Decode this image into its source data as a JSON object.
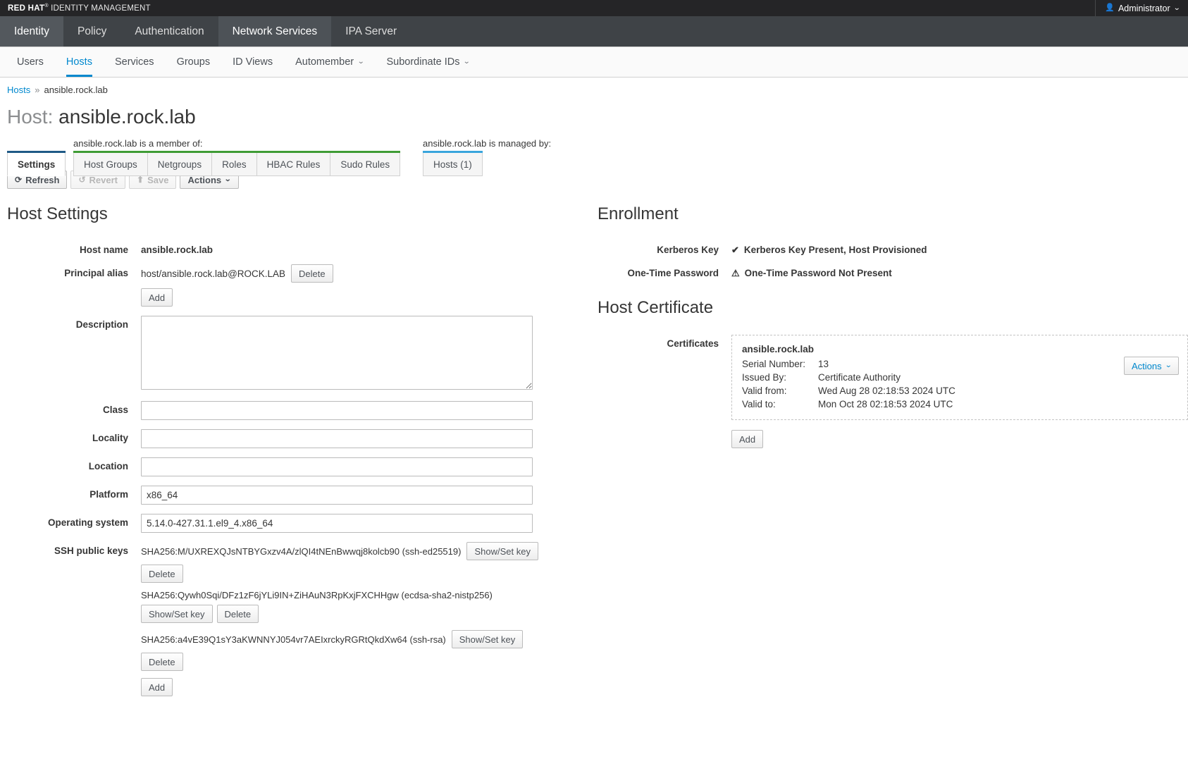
{
  "brand": {
    "red_hat": "RED HAT",
    "registered": "®",
    "product": "IDENTITY MANAGEMENT",
    "user_icon": "user-icon",
    "user_label": "Administrator",
    "caret": "⌄"
  },
  "primary_nav": [
    {
      "label": "Identity",
      "state": "selected"
    },
    {
      "label": "Policy",
      "state": ""
    },
    {
      "label": "Authentication",
      "state": ""
    },
    {
      "label": "Network Services",
      "state": "active"
    },
    {
      "label": "IPA Server",
      "state": ""
    }
  ],
  "secondary_nav": [
    {
      "label": "Users",
      "active": false,
      "caret": ""
    },
    {
      "label": "Hosts",
      "active": true,
      "caret": ""
    },
    {
      "label": "Services",
      "active": false,
      "caret": ""
    },
    {
      "label": "Groups",
      "active": false,
      "caret": ""
    },
    {
      "label": "ID Views",
      "active": false,
      "caret": ""
    },
    {
      "label": "Automember",
      "active": false,
      "caret": "⌄"
    },
    {
      "label": "Subordinate IDs",
      "active": false,
      "caret": "⌄"
    }
  ],
  "breadcrumb": {
    "root": "Hosts",
    "separator": "»",
    "current": "ansible.rock.lab"
  },
  "page_title": {
    "lead": "Host:",
    "value": "ansible.rock.lab"
  },
  "tab_groups": {
    "settings": {
      "label": "Settings"
    },
    "member_of": {
      "caption": "ansible.rock.lab is a member of:",
      "tabs": [
        "Host Groups",
        "Netgroups",
        "Roles",
        "HBAC Rules",
        "Sudo Rules"
      ]
    },
    "managed_by": {
      "caption": "ansible.rock.lab is managed by:",
      "tabs": [
        "Hosts (1)"
      ]
    }
  },
  "toolbar": {
    "refresh": {
      "label": "Refresh",
      "icon": "refresh-icon",
      "glyph": "⟳",
      "disabled": false
    },
    "revert": {
      "label": "Revert",
      "icon": "undo-icon",
      "glyph": "↺",
      "disabled": true
    },
    "save": {
      "label": "Save",
      "icon": "upload-icon",
      "glyph": "⬆",
      "disabled": true
    },
    "actions": {
      "label": "Actions",
      "caret": "⌄",
      "disabled": false
    }
  },
  "host_settings": {
    "title": "Host Settings",
    "host_name": {
      "label": "Host name",
      "value": "ansible.rock.lab"
    },
    "principal_alias": {
      "label": "Principal alias",
      "value": "host/ansible.rock.lab@ROCK.LAB",
      "delete_label": "Delete",
      "add_label": "Add"
    },
    "description": {
      "label": "Description",
      "value": "",
      "placeholder": ""
    },
    "class": {
      "label": "Class",
      "value": "",
      "placeholder": ""
    },
    "locality": {
      "label": "Locality",
      "value": "",
      "placeholder": ""
    },
    "location": {
      "label": "Location",
      "value": "",
      "placeholder": ""
    },
    "platform": {
      "label": "Platform",
      "value": "x86_64",
      "placeholder": ""
    },
    "operating_system": {
      "label": "Operating system",
      "value": "5.14.0-427.31.1.el9_4.x86_64",
      "placeholder": ""
    },
    "ssh_public_keys": {
      "label": "SSH public keys",
      "show_set_label": "Show/Set key",
      "delete_label": "Delete",
      "add_label": "Add",
      "keys": [
        "SHA256:M/UXREXQJsNTBYGxzv4A/zlQI4tNEnBwwqj8kolcb90 (ssh-ed25519)",
        "SHA256:Qywh0Sqi/DFz1zF6jYLi9IN+ZiHAuN3RpKxjFXCHHgw (ecdsa-sha2-nistp256)",
        "SHA256:a4vE39Q1sY3aKWNNYJ054vr7AEIxrckyRGRtQkdXw64 (ssh-rsa)"
      ]
    }
  },
  "enrollment": {
    "title": "Enrollment",
    "kerberos_key": {
      "label": "Kerberos Key",
      "icon": "check-icon",
      "glyph": "✔",
      "status": "Kerberos Key Present, Host Provisioned"
    },
    "one_time_password": {
      "label": "One-Time Password",
      "icon": "warning-icon",
      "glyph": "⚠",
      "status": "One-Time Password Not Present"
    }
  },
  "host_certificate": {
    "title": "Host Certificate",
    "certificates_label": "Certificates",
    "cert": {
      "name": "ansible.rock.lab",
      "serial_number_label": "Serial Number:",
      "serial_number": "13",
      "issued_by_label": "Issued By:",
      "issued_by": "Certificate Authority",
      "valid_from_label": "Valid from:",
      "valid_from": "Wed Aug 28 02:18:53 2024 UTC",
      "valid_to_label": "Valid to:",
      "valid_to": "Mon Oct 28 02:18:53 2024 UTC",
      "actions_label": "Actions",
      "actions_caret": "⌄"
    },
    "add_label": "Add"
  },
  "colors": {
    "brand_bar": "#252527",
    "nav_bar": "#3f4347",
    "accent_blue": "#0088ce",
    "tab_green": "#3f9c35",
    "tab_blue": "#39a5dc",
    "tab_dark_blue": "#1f5a86"
  }
}
